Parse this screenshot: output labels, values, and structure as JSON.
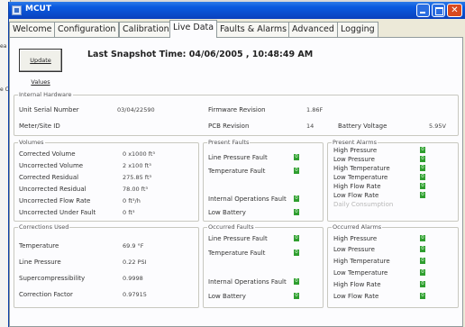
{
  "window": {
    "title": "MCUT"
  },
  "background_window": {
    "fragments": [
      "ea",
      "e C"
    ]
  },
  "tabs": [
    {
      "label": "Welcome"
    },
    {
      "label": "Configuration"
    },
    {
      "label": "Calibration"
    },
    {
      "label": "Live Data"
    },
    {
      "label": "Faults & Alarms"
    },
    {
      "label": "Advanced"
    },
    {
      "label": "Logging"
    }
  ],
  "update_button": {
    "label": "Update Values"
  },
  "snapshot": {
    "text": "Last Snapshot Time: 04/06/2005 , 10:48:49 AM"
  },
  "internal_hardware": {
    "title": "Internal Hardware",
    "serial_label": "Unit Serial Number",
    "serial_value": "03/04/22590",
    "firmware_label": "Firmware Revision",
    "firmware_value": "1.86F",
    "meter_label": "Meter/Site ID",
    "meter_value": "",
    "pcb_label": "PCB Revision",
    "pcb_value": "14",
    "battery_label": "Battery Voltage",
    "battery_value": "5.95V"
  },
  "volumes": {
    "title": "Volumes",
    "rows": [
      {
        "label": "Corrected Volume",
        "value": "0 x1000 ft³"
      },
      {
        "label": "Uncorrected Volume",
        "value": "2 x100 ft³"
      },
      {
        "label": "Corrected Residual",
        "value": "275.85 ft³"
      },
      {
        "label": "Uncorrected Residual",
        "value": "78.00 ft³"
      },
      {
        "label": "Uncorrected Flow Rate",
        "value": "0 ft³/h"
      },
      {
        "label": "Uncorrected Under Fault",
        "value": "0 ft³"
      }
    ]
  },
  "present_faults": {
    "title": "Present Faults",
    "rows": [
      {
        "label": "Line Pressure Fault",
        "status": "0"
      },
      {
        "label": "Temperature Fault",
        "status": "0"
      },
      {
        "label": "Internal Operations Fault",
        "status": "0"
      },
      {
        "label": "Low Battery",
        "status": "0"
      }
    ]
  },
  "present_alarms": {
    "title": "Present Alarms",
    "rows": [
      {
        "label": "High Pressure",
        "status": "0"
      },
      {
        "label": "Low Pressure",
        "status": "0"
      },
      {
        "label": "High Temperature",
        "status": "0"
      },
      {
        "label": "Low Temperature",
        "status": "0"
      },
      {
        "label": "High Flow Rate",
        "status": "0"
      },
      {
        "label": "Low Flow Rate",
        "status": "0"
      }
    ],
    "disabled_label": "Daily Consumption"
  },
  "corrections": {
    "title": "Corrections Used",
    "rows": [
      {
        "label": "Temperature",
        "value": "69.9 °F"
      },
      {
        "label": "Line Pressure",
        "value": "0.22 PSI"
      },
      {
        "label": "Supercompressibility",
        "value": "0.9998"
      },
      {
        "label": "Correction Factor",
        "value": "0.97915"
      }
    ]
  },
  "occurred_faults": {
    "title": "Occurred Faults",
    "rows": [
      {
        "label": "Line Pressure Fault",
        "status": "0"
      },
      {
        "label": "Temperature Fault",
        "status": "0"
      },
      {
        "label": "Internal Operations Fault",
        "status": "0"
      },
      {
        "label": "Low Battery",
        "status": "0"
      }
    ]
  },
  "occurred_alarms": {
    "title": "Occurred Alarms",
    "rows": [
      {
        "label": "High Pressure",
        "status": "0"
      },
      {
        "label": "Low Pressure",
        "status": "0"
      },
      {
        "label": "High Temperature",
        "status": "0"
      },
      {
        "label": "Low Temperature",
        "status": "0"
      },
      {
        "label": "High Flow Rate",
        "status": "0"
      },
      {
        "label": "Low Flow Rate",
        "status": "0"
      }
    ]
  },
  "colors": {
    "titlebar": "#0a4dcc",
    "status_ok": "#2f9e2f",
    "close_button": "#d84a1f",
    "panel_bg": "#fcfcfe"
  }
}
